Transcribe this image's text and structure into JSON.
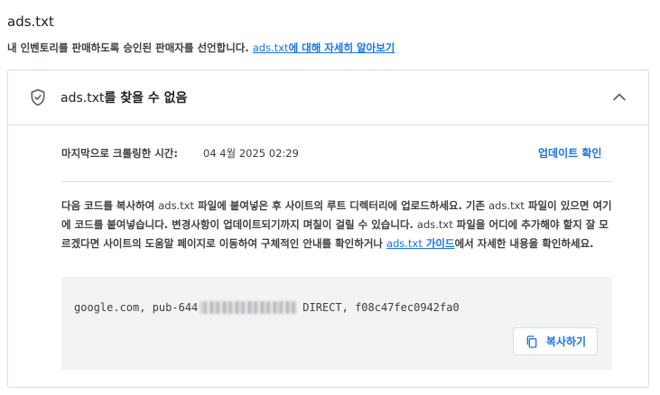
{
  "page": {
    "title": "ads.txt",
    "subtitle_text": "내 인벤토리를 판매하도록 승인된 판매자를 선언합니다. ",
    "subtitle_link_plain": "ads.txt",
    "subtitle_link_bold": "에 대해 자세히 알아보기"
  },
  "card": {
    "title_plain": "ads.txt",
    "title_bold": "를 찾을 수 없음",
    "last_crawled_label": "마지막으로 크롤링한 시간:",
    "last_crawled_value": "04 4월 2025 02:29",
    "update_link": "업데이트 확인",
    "desc_part1": "다음 코드를 복사하여 ",
    "desc_ads1": "ads.txt",
    "desc_part2": " 파일에 붙여넣은 후 사이트의 루트 디렉터리에 업로드하세요. 기존 ",
    "desc_ads2": "ads.txt",
    "desc_part3": " 파일이 있으면 여기에 코드를 붙여넣습니다. 변경사항이 업데이트되기까지 며칠이 걸릴 수 있습니다. ",
    "desc_ads3": "ads.txt",
    "desc_part4": " 파일을 어디에 추가해야 할지 잘 모르겠다면 사이트의 도움말 페이지로 이동하여 구체적인 안내를 확인하거나 ",
    "desc_link_plain": "ads.txt",
    "desc_link_bold": " 가이드",
    "desc_part5": "에서 자세한 내용을 확인하세요.",
    "code_prefix": "google.com, pub-644",
    "code_suffix": "DIRECT, f08c47fec0942fa0",
    "copy_button": "복사하기"
  },
  "icons": {
    "status": "shield-check-icon",
    "collapse": "chevron-up-icon",
    "copy": "copy-icon"
  },
  "colors": {
    "accent": "#1a73e8",
    "border": "#dadce0",
    "code_bg": "#f1f3f4"
  }
}
